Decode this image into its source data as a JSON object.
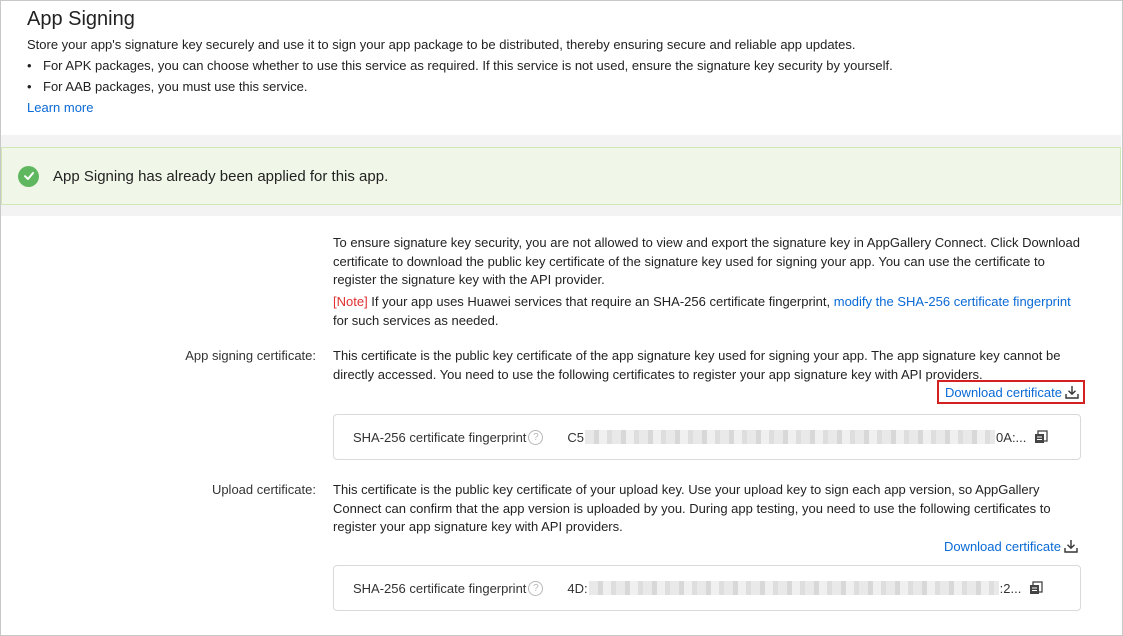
{
  "header": {
    "title": "App Signing",
    "description": "Store your app's signature key securely and use it to sign your app package to be distributed, thereby ensuring secure and reliable app updates.",
    "bullets": [
      "For APK packages, you can choose whether to use this service as required. If this service is not used, ensure the signature key security by yourself.",
      "For AAB packages, you must use this service."
    ],
    "learn_more": "Learn more"
  },
  "status": {
    "message": "App Signing has already been applied for this app.",
    "icon": "check-circle-icon",
    "color": "#5fb85f"
  },
  "intro": {
    "text": "To ensure signature key security, you are not allowed to view and export the signature key in AppGallery Connect. Click Download certificate to download the public key certificate of the signature key used for signing your app. You can use the certificate to register the signature key with the API provider.",
    "note_tag": "[Note]",
    "note_text": " If your app uses Huawei services that require an SHA-256 certificate fingerprint, ",
    "note_link": "modify the SHA-256 certificate fingerprint",
    "note_tail": " for such services as needed."
  },
  "app_signing_cert": {
    "label": "App signing certificate:",
    "text": "This certificate is the public key certificate of the app signature key used for signing your app. The app signature key cannot be directly accessed. You need to use the following certificates to register your app signature key with API providers.",
    "download": "Download certificate",
    "fp_label": "SHA-256 certificate fingerprint",
    "fp_prefix": "C5",
    "fp_suffix": "0A:..."
  },
  "upload_cert": {
    "label": "Upload certificate:",
    "text": "This certificate is the public key certificate of your upload key. Use your upload key to sign each app version, so AppGallery Connect can confirm that the app version is uploaded by you. During app testing, you need to use the following certificates to register your app signature key with API providers.",
    "download": "Download certificate",
    "fp_label": "SHA-256 certificate fingerprint",
    "fp_prefix": "4D:",
    "fp_suffix": ":2..."
  }
}
